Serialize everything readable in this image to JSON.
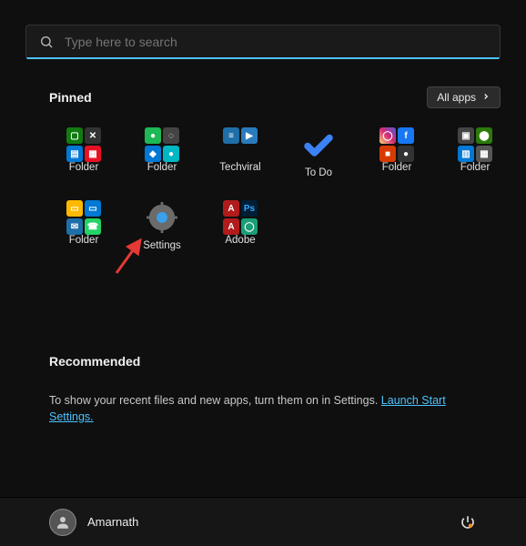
{
  "search": {
    "placeholder": "Type here to search"
  },
  "pinned": {
    "title": "Pinned",
    "all_apps_label": "All apps",
    "items": [
      {
        "label": "Folder"
      },
      {
        "label": "Folder"
      },
      {
        "label": "Techviral"
      },
      {
        "label": "To Do"
      },
      {
        "label": "Folder"
      },
      {
        "label": "Folder"
      },
      {
        "label": "Folder"
      },
      {
        "label": "Settings"
      },
      {
        "label": "Adobe"
      }
    ]
  },
  "recommended": {
    "title": "Recommended",
    "text": "To show your recent files and new apps, turn them on in Settings. ",
    "link_label": "Launch Start Settings."
  },
  "user": {
    "name": "Amarnath"
  }
}
